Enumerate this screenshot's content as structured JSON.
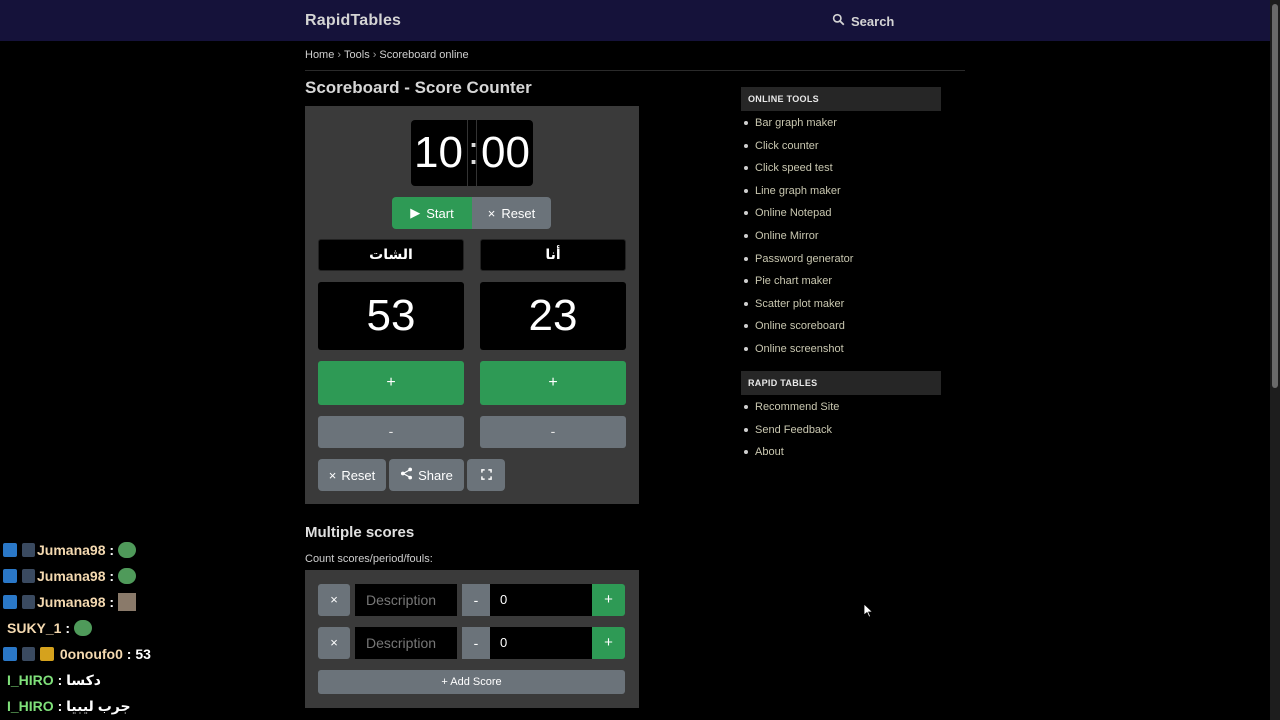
{
  "header": {
    "brand": "RapidTables",
    "search_label": "Search"
  },
  "breadcrumb": {
    "home": "Home",
    "tools": "Tools",
    "current": "Scoreboard online"
  },
  "page": {
    "title": "Scoreboard - Score Counter"
  },
  "timer": {
    "minutes": "10",
    "separator": ":",
    "seconds": "00",
    "start_label": "Start",
    "reset_label": "Reset"
  },
  "teams": [
    {
      "name": "الشات",
      "score": "53",
      "plus_label": "+",
      "minus_label": "-"
    },
    {
      "name": "أنا",
      "score": "23",
      "plus_label": "+",
      "minus_label": "-"
    }
  ],
  "toolbar": {
    "reset_label": "Reset",
    "share_label": "Share"
  },
  "multiple_scores": {
    "title": "Multiple scores",
    "subtitle": "Count scores/period/fouls:",
    "rows": [
      {
        "remove": "×",
        "placeholder": "Description",
        "minus": "-",
        "value": "0",
        "plus": "+"
      },
      {
        "remove": "×",
        "placeholder": "Description",
        "minus": "-",
        "value": "0",
        "plus": "+"
      }
    ],
    "add_label": "+ Add Score"
  },
  "sidebar": {
    "online_tools_heading": "ONLINE TOOLS",
    "online_tools": [
      "Bar graph maker",
      "Click counter",
      "Click speed test",
      "Line graph maker",
      "Online Notepad",
      "Online Mirror",
      "Password generator",
      "Pie chart maker",
      "Scatter plot maker",
      "Online scoreboard",
      "Online screenshot"
    ],
    "rapid_tables_heading": "RAPID TABLES",
    "rapid_tables": [
      "Recommend Site",
      "Send Feedback",
      "About"
    ]
  },
  "chat": [
    {
      "user": "Jumana98",
      "message": ":"
    },
    {
      "user": "Jumana98",
      "message": ":"
    },
    {
      "user": "Jumana98",
      "message": ":"
    },
    {
      "user": "SUKY_1",
      "message": ":"
    },
    {
      "user": "0onoufo0",
      "message": ": 53"
    },
    {
      "user": "I_HIRO",
      "message": ": دكسا"
    },
    {
      "user": "I_HIRO",
      "message": ": جرب ليبيا"
    }
  ],
  "colors": {
    "topbar": "#15123a",
    "green": "#2e9a55",
    "gray_button": "#6b737a",
    "panel": "#3a3a3a"
  }
}
